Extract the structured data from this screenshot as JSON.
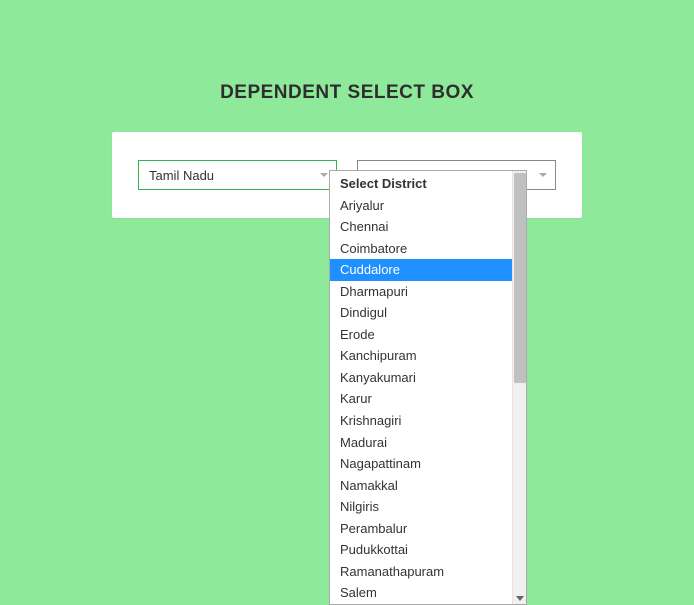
{
  "title": "DEPENDENT SELECT BOX",
  "state_select": {
    "value": "Tamil Nadu"
  },
  "district_select": {
    "value": "Select District",
    "highlighted": "Cuddalore",
    "options": [
      "Select District",
      "Ariyalur",
      "Chennai",
      "Coimbatore",
      "Cuddalore",
      "Dharmapuri",
      "Dindigul",
      "Erode",
      "Kanchipuram",
      "Kanyakumari",
      "Karur",
      "Krishnagiri",
      "Madurai",
      "Nagapattinam",
      "Namakkal",
      "Nilgiris",
      "Perambalur",
      "Pudukkottai",
      "Ramanathapuram",
      "Salem"
    ]
  }
}
